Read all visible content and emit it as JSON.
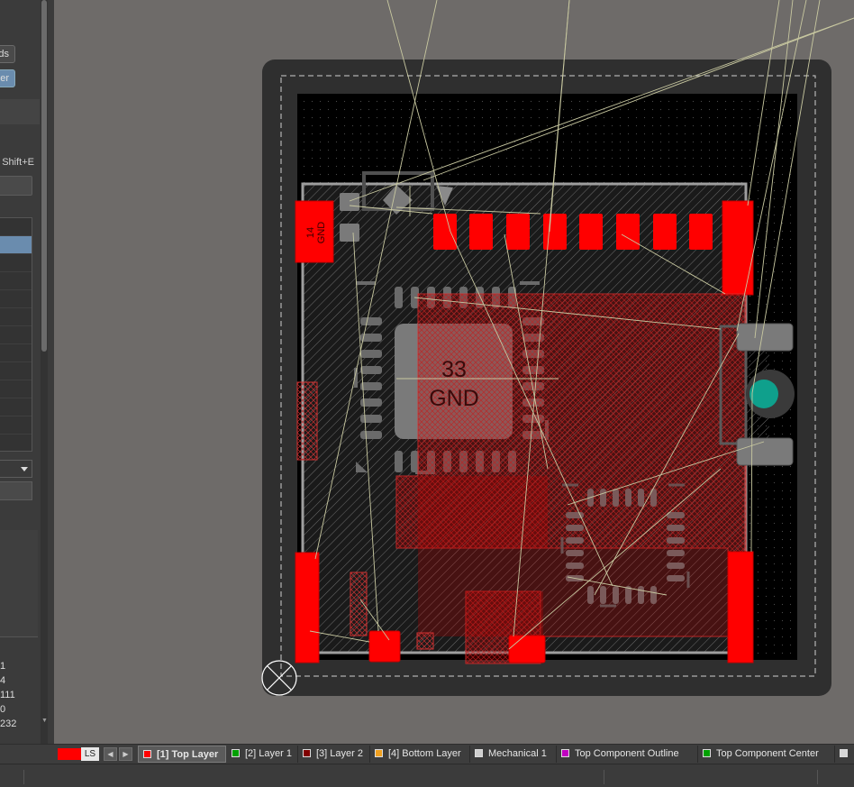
{
  "left_panel": {
    "buttons": [
      {
        "label": "ds",
        "active": false
      },
      {
        "label": "er",
        "active": true
      }
    ],
    "shortcut_text": "Shift+E",
    "numbers": [
      "1",
      "4",
      "111",
      "0",
      "232"
    ]
  },
  "board": {
    "pad_labels": {
      "j1_pin": "14",
      "j1_net": "GND",
      "u1_pin": "33",
      "u1_net": "GND"
    },
    "colors": {
      "workspace": "#6e6b69",
      "board_edge": "#2f2f2f",
      "board_fill": "#000000",
      "top_copper": "#ff0000",
      "silkscreen": "#a0a0a0",
      "ratsnest": "#c8c8a0",
      "bottom_pad_teal": "#0fa08c"
    }
  },
  "layer_bar": {
    "ls_label": "LS",
    "ls_color": "#ff0000",
    "layers": [
      {
        "name": "[1] Top Layer",
        "color": "#ff0000",
        "active": true
      },
      {
        "name": "[2] Layer 1",
        "color": "#00a000",
        "active": false
      },
      {
        "name": "[3] Layer 2",
        "color": "#800000",
        "active": false
      },
      {
        "name": "[4] Bottom Layer",
        "color": "#f0a020",
        "active": false
      },
      {
        "name": "Mechanical 1",
        "color": "#d0d0d0",
        "active": false
      },
      {
        "name": "Top Component Outline",
        "color": "#c000c0",
        "active": false
      },
      {
        "name": "Top Component Center",
        "color": "#00a000",
        "active": false
      }
    ]
  }
}
